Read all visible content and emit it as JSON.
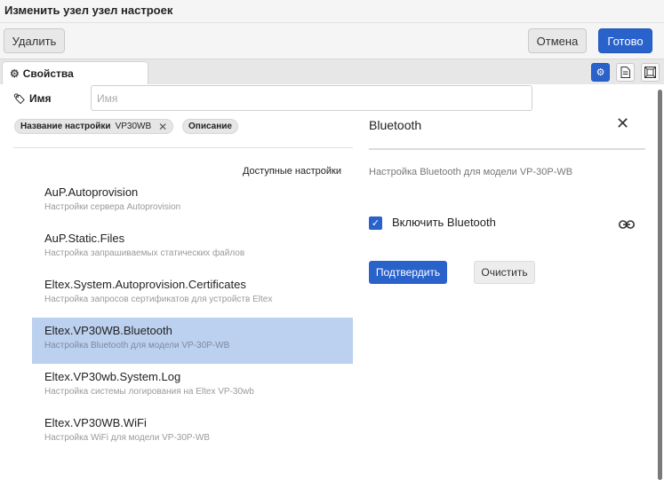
{
  "window": {
    "title": "Изменить узел узел настроек"
  },
  "toolbar": {
    "delete_label": "Удалить",
    "cancel_label": "Отмена",
    "done_label": "Готово"
  },
  "tabs": {
    "properties_label": "Свойства"
  },
  "form": {
    "name_label": "Имя",
    "name_value": "",
    "name_placeholder": "Имя"
  },
  "chips": {
    "setting_name_label": "Название настройки",
    "setting_name_value": "VP30WB",
    "description_label": "Описание"
  },
  "list": {
    "header": "Доступные настройки",
    "items": [
      {
        "title": "AuP.Autoprovision",
        "subtitle": "Настройки сервера Autoprovision"
      },
      {
        "title": "AuP.Static.Files",
        "subtitle": "Настройка запрашиваемых статических файлов"
      },
      {
        "title": "Eltex.System.Autoprovision.Certificates",
        "subtitle": "Настройка запросов сертификатов для устройств Eltex"
      },
      {
        "title": "Eltex.VP30WB.Bluetooth",
        "subtitle": "Настройка Bluetooth для модели VP-30P-WB"
      },
      {
        "title": "Eltex.VP30wb.System.Log",
        "subtitle": "Настройка системы логирования на Eltex VP-30wb"
      },
      {
        "title": "Eltex.VP30WB.WiFi",
        "subtitle": "Настройка WiFi для модели VP-30P-WB"
      }
    ],
    "selected_index": 3
  },
  "detail": {
    "title": "Bluetooth",
    "description": "Настройка Bluetooth для модели VP-30P-WB",
    "checkbox_label": "Включить Bluetooth",
    "checkbox_checked": true,
    "confirm_label": "Подтвердить",
    "clear_label": "Очистить"
  },
  "colors": {
    "accent": "#2a62cc",
    "selected_row": "#bcd0ef"
  }
}
